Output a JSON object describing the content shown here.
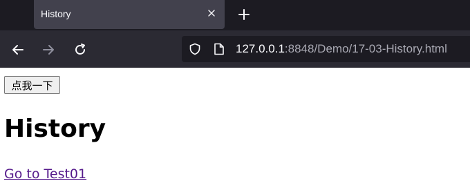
{
  "browser": {
    "tab": {
      "title": "History"
    },
    "url": {
      "host": "127.0.0.1",
      "rest": ":8848/Demo/17-03-History.html"
    }
  },
  "page": {
    "button_label": "点我一下",
    "heading": "History",
    "link_text": "Go to Test01"
  }
}
